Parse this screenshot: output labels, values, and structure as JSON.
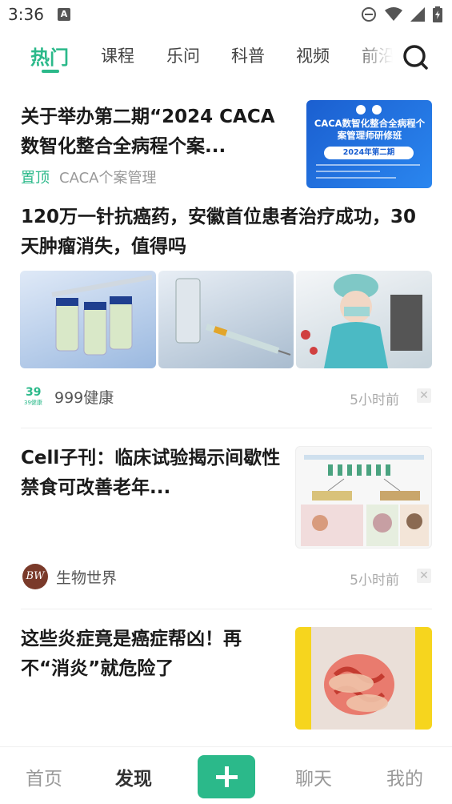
{
  "status": {
    "time": "3:36",
    "notif_letter": "A"
  },
  "tabs": {
    "items": [
      "热门",
      "课程",
      "乐问",
      "科普",
      "视频",
      "前沿"
    ],
    "active_index": 0
  },
  "articles": [
    {
      "title": "关于举办第二期“2024 CACA数智化整合全病程个案...",
      "pin_label": "置顶",
      "source": "CACA个案管理",
      "thumb": {
        "heading": "CACA数智化整合全病程个案管理师研修班",
        "badge": "2024年第二期"
      }
    },
    {
      "title": "120万一针抗癌药，安徽首位患者治疗成功，30天肿瘤消失，值得吗",
      "source": "999健康",
      "source_logo_top": "39",
      "source_logo_bottom": "39健康",
      "time": "5小时前"
    },
    {
      "title": "Cell子刊：临床试验揭示间歇性禁食可改善老年...",
      "source": "生物世界",
      "source_logo": "BW",
      "time": "5小时前"
    },
    {
      "title": "这些炎症竟是癌症帮凶！再不“消炎”就危险了"
    }
  ],
  "bottom_nav": {
    "home": "首页",
    "discover": "发现",
    "chat": "聊天",
    "mine": "我的"
  },
  "colors": {
    "accent": "#2bb98a",
    "blue_banner": "#1f6fd8"
  }
}
